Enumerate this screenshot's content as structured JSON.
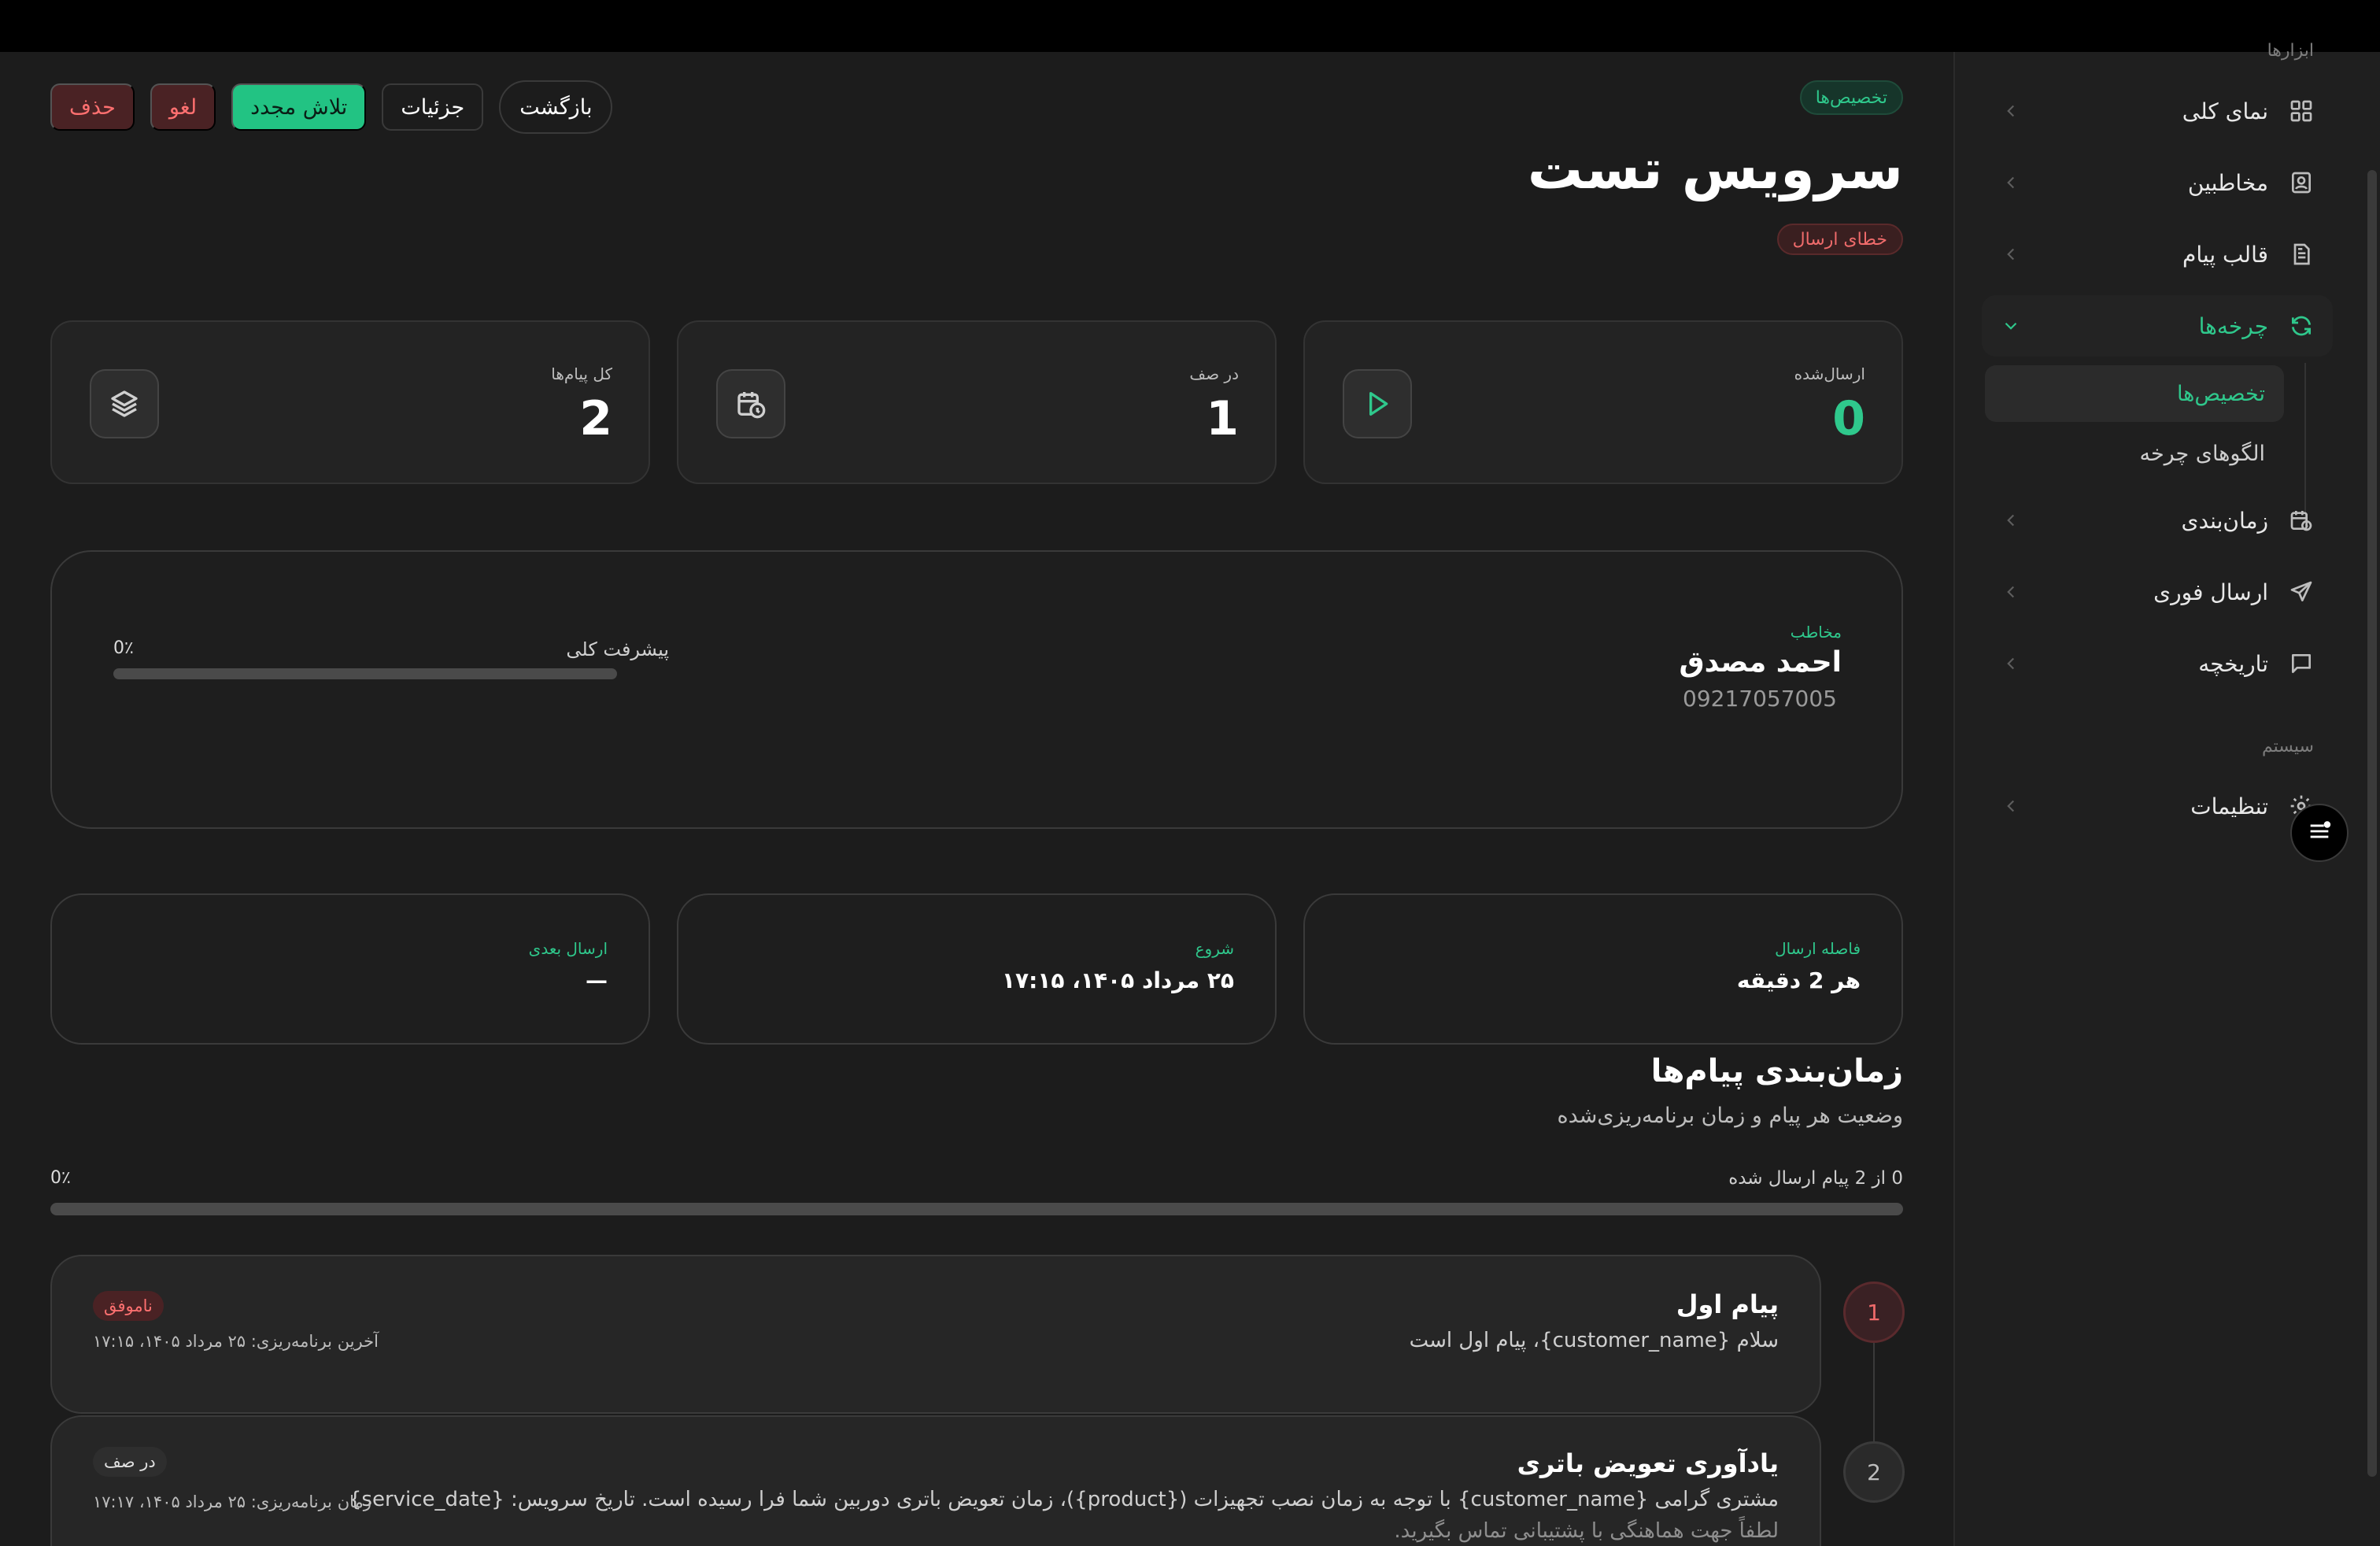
{
  "sidebar": {
    "section_top": "ابزارها",
    "items": [
      {
        "label": "نمای کلی",
        "icon": "dashboard-icon"
      },
      {
        "label": "مخاطبین",
        "icon": "contacts-icon"
      },
      {
        "label": "قالب پیام",
        "icon": "template-icon"
      },
      {
        "label": "چرخه‌ها",
        "icon": "cycle-icon"
      },
      {
        "label": "زمان‌بندی",
        "icon": "schedule-icon"
      },
      {
        "label": "ارسال فوری",
        "icon": "send-icon"
      },
      {
        "label": "تاریخچه",
        "icon": "history-icon"
      }
    ],
    "sub_items": [
      {
        "label": "تخصیص‌ها"
      },
      {
        "label": "الگوهای چرخه"
      }
    ],
    "section_system": "سیستم",
    "settings": {
      "label": "تنظیمات",
      "icon": "settings-icon"
    }
  },
  "header": {
    "breadcrumb": "تخصیص‌ها",
    "title": "سرویس تست",
    "status": "خطای ارسال",
    "actions": {
      "delete": "حذف",
      "cancel": "لغو",
      "retry": "تلاش مجدد",
      "details": "جزئیات",
      "back": "بازگشت"
    }
  },
  "stats": [
    {
      "label": "ارسال‌شده",
      "value": "0",
      "icon": "play-icon"
    },
    {
      "label": "در صف",
      "value": "1",
      "icon": "calendar-clock-icon"
    },
    {
      "label": "کل پیام‌ها",
      "value": "2",
      "icon": "layers-icon"
    }
  ],
  "contact": {
    "label": "مخاطب",
    "name": "احمد مصدق",
    "phone": "09217057005",
    "progress_label": "پیشرفت کلی",
    "progress_pct": "0٪",
    "progress_value": 0
  },
  "info": [
    {
      "label": "فاصله ارسال",
      "value": "هر 2 دقیقه"
    },
    {
      "label": "شروع",
      "value": "۲۵ مرداد ۱۴۰۵، ۱۷:۱۵"
    },
    {
      "label": "ارسال بعدی",
      "value": "—"
    }
  ],
  "schedule": {
    "title": "زمان‌بندی پیام‌ها",
    "subtitle": "وضعیت هر پیام و زمان برنامه‌ریزی‌شده",
    "count_text": "0 از 2 پیام ارسال شده",
    "pct": "0٪",
    "progress_value": 0,
    "messages": [
      {
        "step": "1",
        "title": "پیام اول",
        "body": "سلام {customer_name}، پیام اول است",
        "badge": "ناموفق",
        "sched": "آخرین برنامه‌ریزی: ۲۵ مرداد ۱۴۰۵، ۱۷:۱۵"
      },
      {
        "step": "2",
        "title": "یادآوری تعویض باتری",
        "body": "مشتری گرامی {customer_name} با توجه به زمان نصب تجهیزات ({product})، زمان تعویض باتری دوربین شما فرا رسیده است. تاریخ سرویس: {service_date}",
        "body2": "لطفاً جهت هماهنگی با پشتیبانی تماس بگیرید.",
        "badge": "در صف",
        "sched": "زمان برنامه‌ریزی: ۲۵ مرداد ۱۴۰۵، ۱۷:۱۷"
      }
    ]
  },
  "colors": {
    "accent": "#2fc88c",
    "danger": "#ff7070",
    "background": "#1c1c1c",
    "card": "#232323"
  }
}
